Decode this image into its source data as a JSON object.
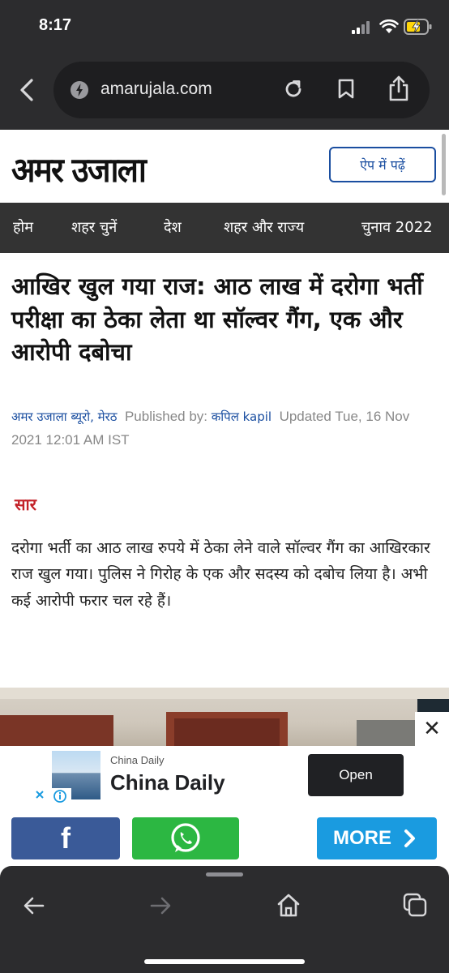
{
  "status_bar": {
    "time": "8:17"
  },
  "browser": {
    "url": "amarujala.com"
  },
  "site": {
    "logo": "अमर उजाला",
    "app_button": "ऐप में पढ़ें",
    "nav": [
      "होम",
      "शहर चुनें",
      "देश",
      "शहर और राज्य",
      "चुनाव 2022"
    ]
  },
  "article": {
    "headline": "आखिर खुल गया राज: आठ लाख में दरोगा भर्ती परीक्षा का ठेका लेता था सॉल्वर गैंग, एक और आरोपी दबोचा",
    "bureau": "अमर उजाला ब्यूरो, मेरठ",
    "published_label": "Published by:",
    "author": "कपिल kapil",
    "updated_label": "Updated",
    "updated_time": "Tue, 16 Nov 2021 12:01 AM IST",
    "summary_label": "सार",
    "summary": "दरोगा भर्ती का आठ लाख रुपये में ठेका लेने वाले सॉल्वर गैंग का आखिरकार राज खुल गया। पुलिस ने गिरोह के एक और सदस्य को दबोच लिया है। अभी कई आरोपी फरार चल रहे हैं।"
  },
  "ad": {
    "advertiser_small": "China Daily",
    "advertiser_big": "China Daily",
    "cta": "Open"
  },
  "share": {
    "facebook": "f",
    "more": "MORE"
  },
  "colors": {
    "chrome": "#2c2c2e",
    "nav": "#333333",
    "accent_blue": "#1a4ea0",
    "saar_red": "#c32027",
    "facebook": "#3a5a98",
    "whatsapp": "#2cb742",
    "more": "#1a9be0"
  }
}
